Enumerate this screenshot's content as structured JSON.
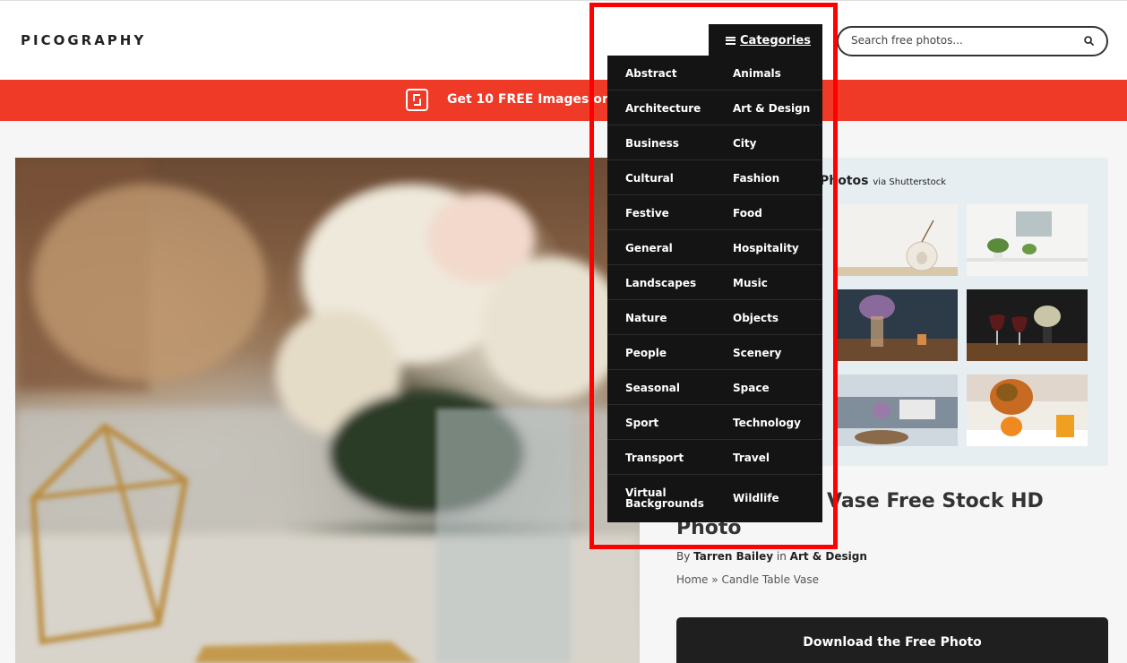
{
  "header": {
    "logo": "PICOGRAPHY",
    "categories_label": "Categories",
    "search_placeholder": "Search free photos..."
  },
  "promo": {
    "text": "Get 10 FREE Images on S"
  },
  "shutterstock": {
    "title": "Photos",
    "via": "via Shutterstock"
  },
  "photo": {
    "title": "Candle Table Vase Free Stock HD Photo",
    "title_visible_line1": "Vase Free Stock HD",
    "title_visible_line2": "Photo",
    "by_label": "By",
    "author": "Tarren Bailey",
    "in_label": "in",
    "category": "Art & Design",
    "breadcrumb_home": "Home",
    "breadcrumb_sep": "»",
    "breadcrumb_current": "Candle Table Vase",
    "download_label": "Download the Free Photo"
  },
  "categories": [
    [
      "Abstract",
      "Animals"
    ],
    [
      "Architecture",
      "Art & Design"
    ],
    [
      "Business",
      "City"
    ],
    [
      "Cultural",
      "Fashion"
    ],
    [
      "Festive",
      "Food"
    ],
    [
      "General",
      "Hospitality"
    ],
    [
      "Landscapes",
      "Music"
    ],
    [
      "Nature",
      "Objects"
    ],
    [
      "People",
      "Scenery"
    ],
    [
      "Seasonal",
      "Space"
    ],
    [
      "Sport",
      "Technology"
    ],
    [
      "Transport",
      "Travel"
    ],
    [
      "Virtual Backgrounds",
      "Wildlife"
    ]
  ],
  "colors": {
    "accent": "#ee3a27",
    "dropdown_bg": "#141414",
    "highlight": "#ff0000"
  }
}
